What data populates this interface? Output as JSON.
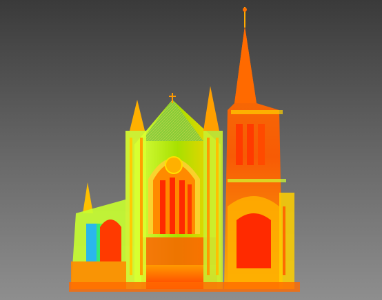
{
  "viewer": {
    "type": "point-cloud-viewport",
    "subject": "cathedral-laser-scan",
    "background_top": "#3a3a3a",
    "background_bottom": "#8e8e8e",
    "colormap": [
      "#ff2a00",
      "#ff7a00",
      "#ffc400",
      "#c8ff00",
      "#3cff3c",
      "#19b0ff"
    ]
  }
}
